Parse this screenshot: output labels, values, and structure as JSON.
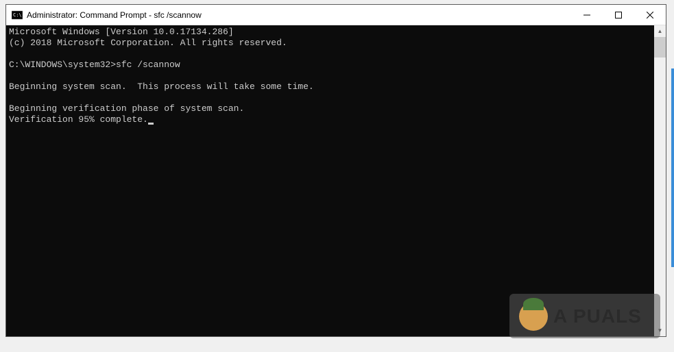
{
  "window": {
    "title": "Administrator: Command Prompt - sfc  /scannow"
  },
  "console": {
    "line1": "Microsoft Windows [Version 10.0.17134.286]",
    "line2": "(c) 2018 Microsoft Corporation. All rights reserved.",
    "blank1": "",
    "prompt_line": "C:\\WINDOWS\\system32>sfc /scannow",
    "blank2": "",
    "scan_line": "Beginning system scan.  This process will take some time.",
    "blank3": "",
    "verify_line1": "Beginning verification phase of system scan.",
    "verify_line2": "Verification 95% complete."
  },
  "watermark": {
    "text": "A  PUALS"
  }
}
